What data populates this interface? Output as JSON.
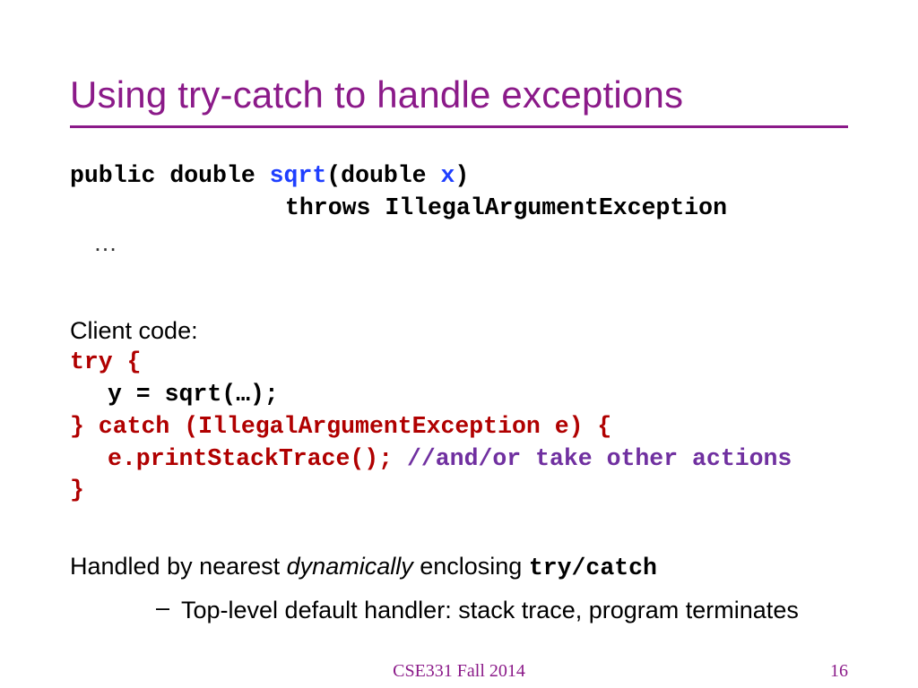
{
  "title": "Using try-catch to handle exceptions",
  "sig": {
    "p1": "public double ",
    "p2": "sqrt",
    "p3": "(double ",
    "p4": "x",
    "p5": ")",
    "throws": "throws IllegalArgumentException",
    "ellipsis": "…"
  },
  "client_label": "Client code:",
  "code": {
    "l1": "try {",
    "l2": "y = sqrt(…);",
    "l3": "} catch (IllegalArgumentException e) {",
    "l4a": "e.printStackTrace();",
    "l4b": " //and/or take other actions",
    "l5": "}"
  },
  "note": {
    "pre": "Handled by nearest ",
    "ital": "dynamically",
    "mid": " enclosing ",
    "mono": "try/catch"
  },
  "bullet": {
    "dash": "–",
    "text": "Top-level default handler:  stack trace, program terminates"
  },
  "footer": {
    "center": "CSE331 Fall 2014",
    "page": "16"
  }
}
